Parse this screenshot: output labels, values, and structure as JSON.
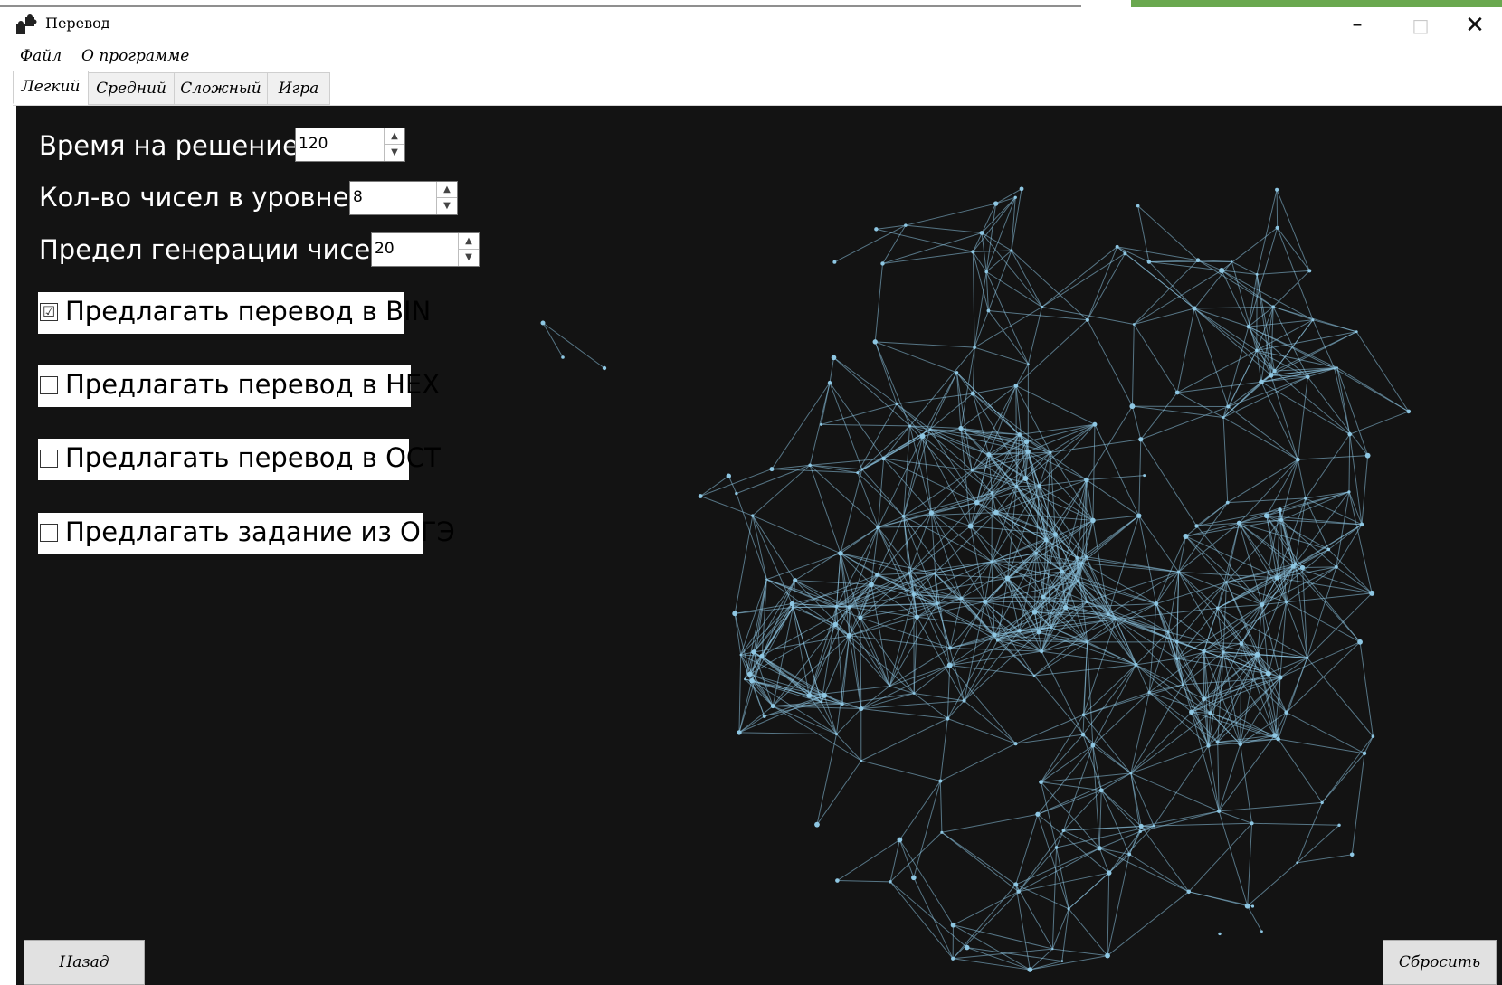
{
  "window": {
    "title": "Перевод",
    "controls": {
      "minimize": "–",
      "maximize": "□",
      "close": "✕"
    }
  },
  "menu": {
    "items": [
      {
        "label": "Файл"
      },
      {
        "label": "О программе"
      }
    ]
  },
  "tabs": [
    {
      "label": "Легкий",
      "active": true
    },
    {
      "label": "Средний",
      "active": false
    },
    {
      "label": "Сложный",
      "active": false
    },
    {
      "label": "Игра",
      "active": false
    }
  ],
  "settings": {
    "time": {
      "label": "Время на решение:",
      "value": "120"
    },
    "count": {
      "label": "Кол-во чисел в уровне:",
      "value": "8"
    },
    "limit": {
      "label": "Предел генерации чисел:",
      "value": "20"
    }
  },
  "options": [
    {
      "label": "Предлагать перевод в BIN",
      "checked": true,
      "mark": "☑"
    },
    {
      "label": "Предлагать перевод в HEX",
      "checked": false,
      "mark": ""
    },
    {
      "label": "Предлагать перевод в OCT",
      "checked": false,
      "mark": ""
    },
    {
      "label": "Предлагать задание из ОГЭ",
      "checked": false,
      "mark": ""
    }
  ],
  "buttons": {
    "back": "Назад",
    "reset": "Сбросить"
  },
  "colors": {
    "background": "#131313",
    "network": "#8ec7e3",
    "accent": "#6aa84f"
  },
  "icons": {
    "app": "puzzle-icon",
    "spin_up": "spin-up-icon",
    "spin_down": "spin-down-icon"
  }
}
